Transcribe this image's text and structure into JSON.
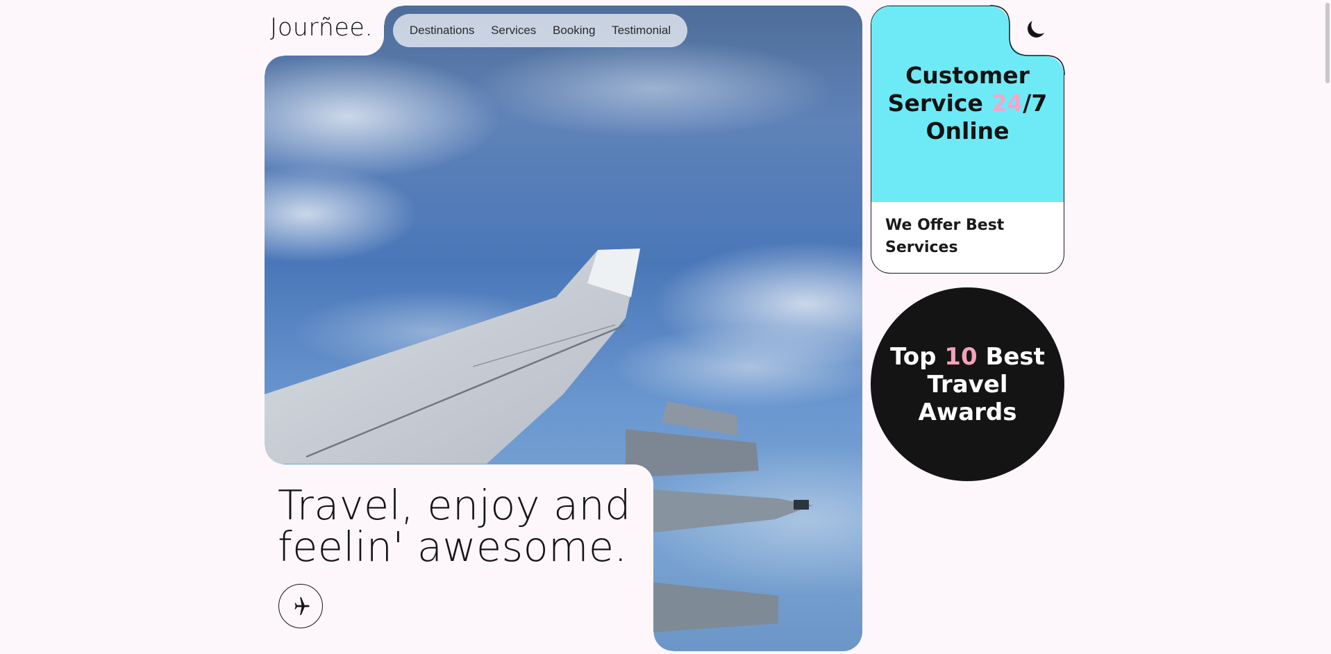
{
  "brand": {
    "logo": "Jourñee."
  },
  "nav": {
    "items": [
      {
        "label": "Destinations"
      },
      {
        "label": "Services"
      },
      {
        "label": "Booking"
      },
      {
        "label": "Testimonial"
      }
    ]
  },
  "hero": {
    "headline_line1": "Travel, enjoy and",
    "headline_line2": "feelin' awesome.",
    "cta_icon": "airplane-icon",
    "image_subject": "airplane-wing-over-clouds"
  },
  "customer_service": {
    "title_line1": "Customer",
    "title_line2_a": "Service ",
    "title_line2_highlight": "24",
    "title_line2_b": "/7",
    "title_line3": "Online",
    "subtitle": "We Offer Best Services",
    "bg_color": "#6eeaf7",
    "highlight_color": "#f2a6c9"
  },
  "awards": {
    "line1_a": "Top ",
    "line1_highlight": "10",
    "line1_b": " Best",
    "line2": "Travel",
    "line3": "Awards",
    "bg_color": "#141414",
    "highlight_color": "#f3a2b8"
  },
  "theme_toggle": {
    "icon": "moon-icon"
  },
  "colors": {
    "page_bg": "#fdf7fb",
    "text": "#141414"
  }
}
